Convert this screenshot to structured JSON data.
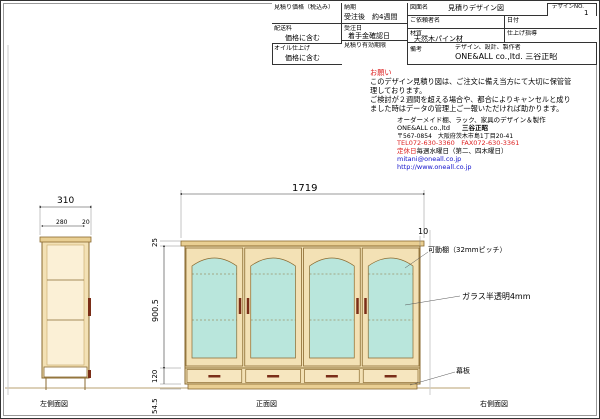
{
  "title_block": {
    "estimate_price_label": "見積り価格（税込み）",
    "estimate_price_value": "",
    "delivery_label": "配送料",
    "delivery_value": "価格に含む",
    "oil_label": "オイル仕上げ",
    "oil_value": "価格に含む",
    "delivery_date_label": "納期",
    "delivery_date_value": "受注後　約4週間",
    "order_label": "受注日",
    "order_value": "着手金確認日",
    "validity_label": "見積り有効期限",
    "drawing_name_label": "図面名",
    "drawing_name_value": "見積りデザイン図",
    "design_no_label": "デザインNO.",
    "design_no_value": "1",
    "customer_label": "ご依頼者名",
    "date_label": "日付",
    "material_label": "材質",
    "material_value": "天然木パイン材",
    "finish_label": "仕上げ指導",
    "company_label": "備考",
    "company_sub_label": "デザイン、設計、製作者",
    "company_value": "ONE&ALL co.,ltd. 三谷正昭"
  },
  "notice": {
    "heading": "お願い",
    "lines": [
      "このデザイン見積り図は、ご注文に備え当方にて大切に保管管",
      "理しております。",
      "ご検討が２週間を超える場合や、都合によりキャンセルと成り",
      "ました時はデータの管理上ご一報いただければ助かります。"
    ]
  },
  "company": {
    "tagline": "オーダーメイド棚、ラック、家具のデザイン＆製作",
    "name": "ONE&ALL co.,ltd",
    "person": "三谷正昭",
    "address": "〒567-0854　大阪府茨木市島1丁目20-41",
    "tel": "TEL072-630-3360　FAX072-630-3361",
    "holiday_prefix": "定休日",
    "holiday_text": "毎週水曜日（第二、四木曜日）",
    "email": "mitani@oneall.co.jp",
    "url": "http://www.oneall.co.jp"
  },
  "drawing": {
    "side_width": "310",
    "side_inner": "280",
    "side_back": "20",
    "front_width": "1719",
    "top_thickness": "25",
    "body_height": "900.5",
    "drawer_height": "120",
    "plinth_height": "54.5",
    "right_offset": "10",
    "label_shelf": "可動棚（32mmピッチ）",
    "label_glass": "ガラス半透明4mm",
    "label_plinth": "幕板",
    "view_left": "左側面図",
    "view_front": "正面図",
    "view_right": "右側面図"
  }
}
